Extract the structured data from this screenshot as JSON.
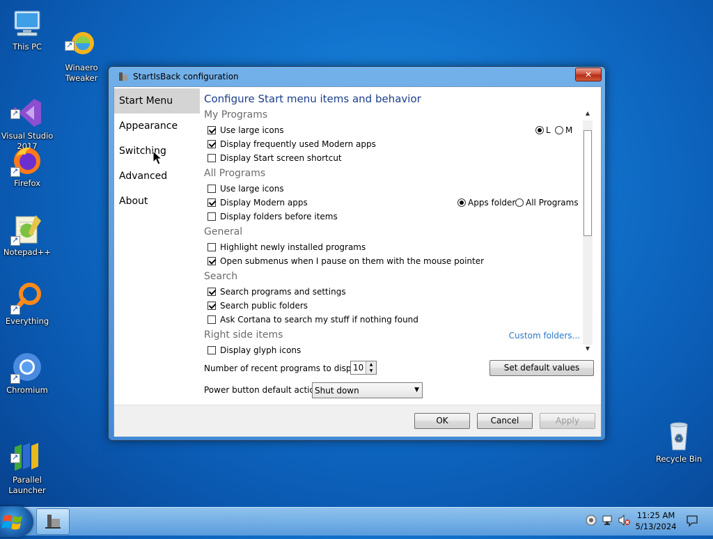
{
  "desktop": {
    "icons": [
      {
        "label": "This PC",
        "icon": "computer-icon"
      },
      {
        "label": "Winaero\nTweaker",
        "icon": "winaero-icon"
      },
      {
        "label": "Visual Studio\n2017",
        "icon": "visual-studio-icon"
      },
      {
        "label": "Firefox",
        "icon": "firefox-icon"
      },
      {
        "label": "Notepad++",
        "icon": "notepadpp-icon"
      },
      {
        "label": "Everything",
        "icon": "everything-icon"
      },
      {
        "label": "Chromium",
        "icon": "chromium-icon"
      },
      {
        "label": "Parallel\nLauncher",
        "icon": "parallel-launcher-icon"
      },
      {
        "label": "Recycle Bin",
        "icon": "recycle-bin-icon"
      }
    ]
  },
  "window": {
    "title": "StartIsBack configuration",
    "close_label": "✕",
    "nav": [
      "Start Menu",
      "Appearance",
      "Switching",
      "Advanced",
      "About"
    ],
    "heading": "Configure Start menu items and behavior",
    "sections": {
      "my_programs": {
        "title": "My Programs",
        "options": [
          {
            "label": "Use large icons",
            "checked": true
          },
          {
            "label": "Display frequently used Modern apps",
            "checked": true
          },
          {
            "label": "Display Start screen shortcut",
            "checked": false
          }
        ],
        "size_radio": [
          {
            "label": "L",
            "selected": true
          },
          {
            "label": "M",
            "selected": false
          }
        ]
      },
      "all_programs": {
        "title": "All Programs",
        "options": [
          {
            "label": "Use large icons",
            "checked": false
          },
          {
            "label": "Display Modern apps",
            "checked": true
          },
          {
            "label": "Display folders before items",
            "checked": false
          }
        ],
        "modern_radio": [
          {
            "label": "Apps folder",
            "selected": true
          },
          {
            "label": "All Programs",
            "selected": false
          }
        ]
      },
      "general": {
        "title": "General",
        "options": [
          {
            "label": "Highlight newly installed programs",
            "checked": false
          },
          {
            "label": "Open submenus when I pause on them with the mouse pointer",
            "checked": true
          }
        ]
      },
      "search": {
        "title": "Search",
        "options": [
          {
            "label": "Search programs and settings",
            "checked": true
          },
          {
            "label": "Search public folders",
            "checked": true
          },
          {
            "label": "Ask Cortana to search my stuff if nothing found",
            "checked": false
          }
        ]
      },
      "right_side": {
        "title": "Right side items",
        "link": "Custom folders...",
        "options": [
          {
            "label": "Display glyph icons",
            "checked": false
          }
        ]
      }
    },
    "recent_label": "Number of recent programs to display:",
    "recent_value": "10",
    "default_button": "Set default values",
    "power_label": "Power button default action:",
    "power_value": "Shut down",
    "ok": "OK",
    "cancel": "Cancel",
    "apply": "Apply"
  },
  "taskbar": {
    "time": "11:25 AM",
    "date": "5/13/2024"
  },
  "colors": {
    "desktop": "#1172cc",
    "heading": "#1a3e8c",
    "link": "#2a78c8"
  }
}
